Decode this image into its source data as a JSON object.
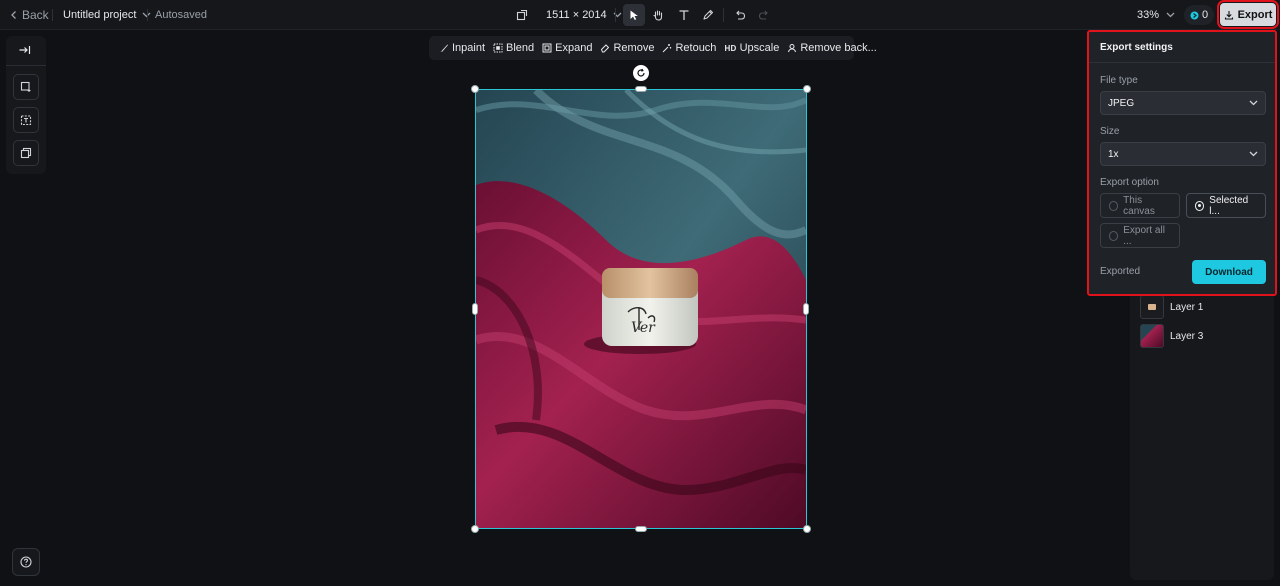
{
  "topbar": {
    "back_label": "Back",
    "project_title": "Untitled project",
    "save_status": "Autosaved",
    "dimensions": "1511 × 2014",
    "zoom": "33%",
    "credits": "0",
    "export_label": "Export"
  },
  "ai_toolbar": {
    "items": [
      "Inpaint",
      "Blend",
      "Expand",
      "Remove",
      "Retouch",
      "Upscale",
      "Remove back..."
    ],
    "upscale_badge": "HD"
  },
  "export_panel": {
    "title": "Export settings",
    "file_type_label": "File type",
    "file_type_value": "JPEG",
    "size_label": "Size",
    "size_value": "1x",
    "export_option_label": "Export option",
    "options": [
      "This canvas",
      "Selected l...",
      "Export all ..."
    ],
    "selected_option": "Selected l...",
    "status": "Exported",
    "download_label": "Download"
  },
  "layers": [
    {
      "name": "Layer 1"
    },
    {
      "name": "Layer 3"
    }
  ],
  "product_text": "Ver",
  "colors": {
    "accent": "#1ec8e0",
    "highlight": "#e0121b",
    "selection": "#2ac6d6"
  }
}
